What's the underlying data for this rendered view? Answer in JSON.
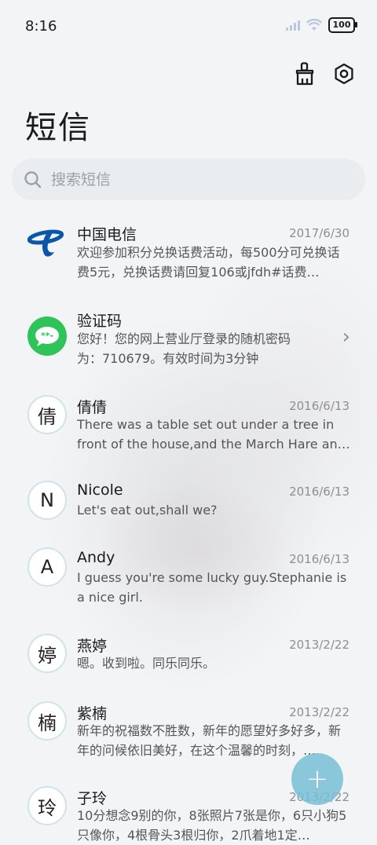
{
  "status": {
    "time": "8:16",
    "battery": "100"
  },
  "header": {
    "title": "短信"
  },
  "search": {
    "placeholder": "搜索短信"
  },
  "threads": [
    {
      "avatar": "",
      "avatar_type": "telecom-logo",
      "name": "中国电信",
      "date": "2017/6/30",
      "preview": "欢迎参加积分兑换话费活动，每500分可兑换话费5元，兑换话费请回复106或jfdh#话费…"
    },
    {
      "avatar": "",
      "avatar_type": "message-icon",
      "name": "验证码",
      "date": "",
      "preview": "您好！您的网上营业厅登录的随机密码为：710679。有效时间为3分钟"
    },
    {
      "avatar": "倩",
      "avatar_type": "initial",
      "name": "倩倩",
      "date": "2016/6/13",
      "preview": "There was a table set out under a tree in front of the house,and the March Hare an…"
    },
    {
      "avatar": "N",
      "avatar_type": "initial",
      "name": "Nicole",
      "date": "2016/6/13",
      "preview": "Let's eat out,shall we?"
    },
    {
      "avatar": "A",
      "avatar_type": "initial",
      "name": "Andy",
      "date": "2016/6/13",
      "preview": "I guess you're some lucky guy.Stephanie is a nice girl."
    },
    {
      "avatar": "婷",
      "avatar_type": "initial",
      "name": "燕婷",
      "date": "2013/2/22",
      "preview": "嗯。收到啦。同乐同乐。"
    },
    {
      "avatar": "楠",
      "avatar_type": "initial",
      "name": "紫楠",
      "date": "2013/2/22",
      "preview": "新年的祝福数不胜数，新年的愿望好多好多，新年的问候依旧美好，在这个温馨的时刻，…"
    },
    {
      "avatar": "玲",
      "avatar_type": "initial",
      "name": "子玲",
      "date": "2013/2/22",
      "preview": "10分想念9别的你，8张照片7张是你，6只小狗5只像你，4根骨头3根归你，2爪着地1定…"
    }
  ],
  "fab": {
    "label": "+"
  },
  "colors": {
    "accent": "#78bed6",
    "telecom": "#0a56a8",
    "message_green": "#2fc45a"
  }
}
